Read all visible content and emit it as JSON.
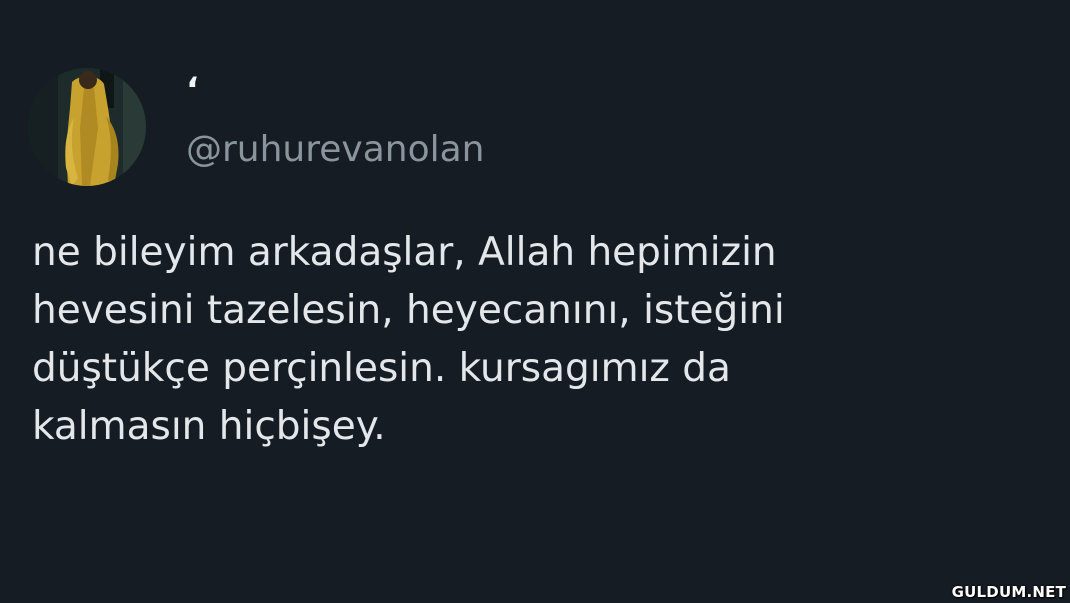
{
  "tweet": {
    "display_name": "‘",
    "handle": "@ruhurevanolan",
    "text": "ne bileyim arkadaşlar, Allah hepimizin\nhevesini tazelesin, heyecanını, isteğini\ndüştükçe perçinlesin. kursagımız da\nkalmasın hiçbişey."
  },
  "watermark": {
    "text": "GULDUM.NET"
  },
  "colors": {
    "background": "#151c24",
    "text": "#e4e7ea",
    "handle": "#8b949c",
    "avatar_coat": "#c8a22e"
  },
  "icons": {
    "avatar": "profile-photo"
  }
}
